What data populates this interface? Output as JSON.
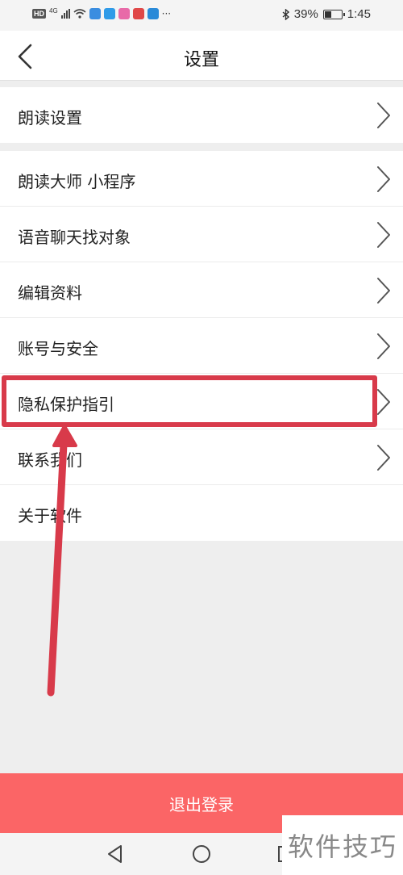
{
  "status": {
    "left_tags": [
      "HD",
      "4G"
    ],
    "more": "···",
    "battery": "39%",
    "battery_level": 0.39,
    "time": "1:45"
  },
  "header": {
    "title": "设置"
  },
  "groups": [
    {
      "items": [
        {
          "label": "朗读设置"
        }
      ]
    },
    {
      "items": [
        {
          "label": "朗读大师 小程序"
        },
        {
          "label": "语音聊天找对象"
        },
        {
          "label": "编辑资料"
        },
        {
          "label": "账号与安全"
        },
        {
          "label": "隐私保护指引"
        },
        {
          "label": "联系我们"
        },
        {
          "label": "关于软件"
        }
      ]
    }
  ],
  "logout_label": "退出登录",
  "watermark": "软件技巧",
  "colors": {
    "logout": "#fb6566",
    "highlight": "#d83a4a"
  }
}
